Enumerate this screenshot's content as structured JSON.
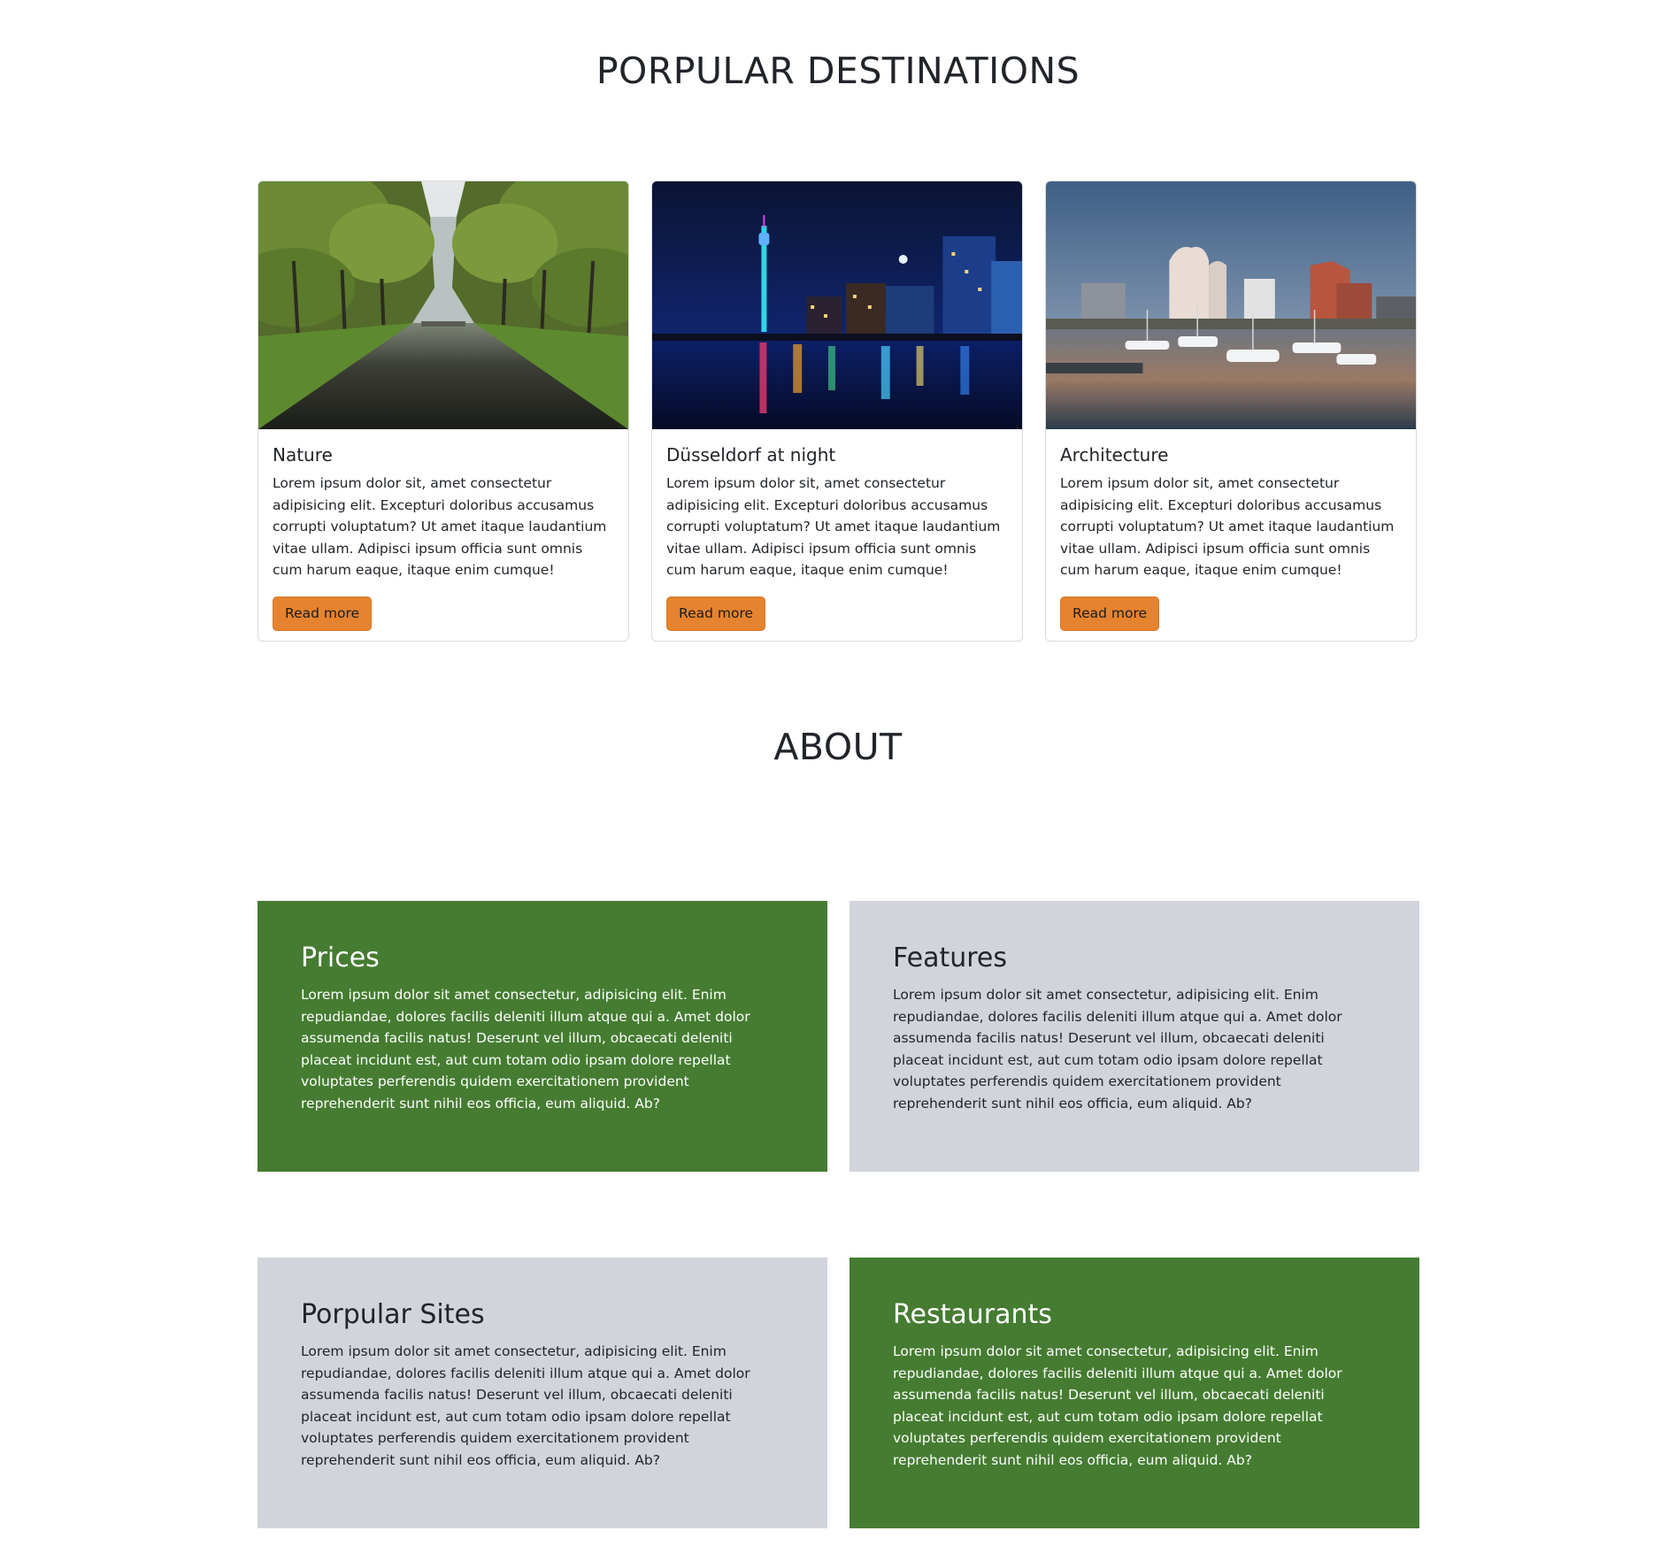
{
  "destinations": {
    "title": "PORPULAR DESTINATIONS",
    "cards": [
      {
        "title": "Nature",
        "text": "Lorem ipsum dolor sit, amet consectetur adipisicing elit. Excepturi doloribus accusamus corrupti voluptatum? Ut amet itaque laudantium vitae ullam. Adipisci ipsum officia sunt omnis cum harum eaque, itaque enim cumque!",
        "button": "Read more",
        "image": "tree-lined-canal-photo"
      },
      {
        "title": "Düsseldorf at night",
        "text": "Lorem ipsum dolor sit, amet consectetur adipisicing elit. Excepturi doloribus accusamus corrupti voluptatum? Ut amet itaque laudantium vitae ullam. Adipisci ipsum officia sunt omnis cum harum eaque, itaque enim cumque!",
        "button": "Read more",
        "image": "city-skyline-at-night-photo"
      },
      {
        "title": "Architecture",
        "text": "Lorem ipsum dolor sit, amet consectetur adipisicing elit. Excepturi doloribus accusamus corrupti voluptatum? Ut amet itaque laudantium vitae ullam. Adipisci ipsum officia sunt omnis cum harum eaque, itaque enim cumque!",
        "button": "Read more",
        "image": "harbor-architecture-photo"
      }
    ]
  },
  "about": {
    "title": "ABOUT",
    "boxes": [
      {
        "title": "Prices",
        "text": "Lorem ipsum dolor sit amet consectetur, adipisicing elit. Enim repudiandae, dolores facilis deleniti illum atque qui a. Amet dolor assumenda facilis natus! Deserunt vel illum, obcaecati deleniti placeat incidunt est, aut cum totam odio ipsam dolore repellat voluptates perferendis quidem exercitationem provident reprehenderit sunt nihil eos officia, eum aliquid. Ab?"
      },
      {
        "title": "Features",
        "text": "Lorem ipsum dolor sit amet consectetur, adipisicing elit. Enim repudiandae, dolores facilis deleniti illum atque qui a. Amet dolor assumenda facilis natus! Deserunt vel illum, obcaecati deleniti placeat incidunt est, aut cum totam odio ipsam dolore repellat voluptates perferendis quidem exercitationem provident reprehenderit sunt nihil eos officia, eum aliquid. Ab?"
      },
      {
        "title": "Porpular Sites",
        "text": "Lorem ipsum dolor sit amet consectetur, adipisicing elit. Enim repudiandae, dolores facilis deleniti illum atque qui a. Amet dolor assumenda facilis natus! Deserunt vel illum, obcaecati deleniti placeat incidunt est, aut cum totam odio ipsam dolore repellat voluptates perferendis quidem exercitationem provident reprehenderit sunt nihil eos officia, eum aliquid. Ab?"
      },
      {
        "title": "Restaurants",
        "text": "Lorem ipsum dolor sit amet consectetur, adipisicing elit. Enim repudiandae, dolores facilis deleniti illum atque qui a. Amet dolor assumenda facilis natus! Deserunt vel illum, obcaecati deleniti placeat incidunt est, aut cum totam odio ipsam dolore repellat voluptates perferendis quidem exercitationem provident reprehenderit sunt nihil eos officia, eum aliquid. Ab?"
      }
    ]
  },
  "colors": {
    "accent_orange": "#e5832e",
    "box_green": "#457c31",
    "box_grey": "#d1d5db",
    "text_dark": "#212529"
  }
}
